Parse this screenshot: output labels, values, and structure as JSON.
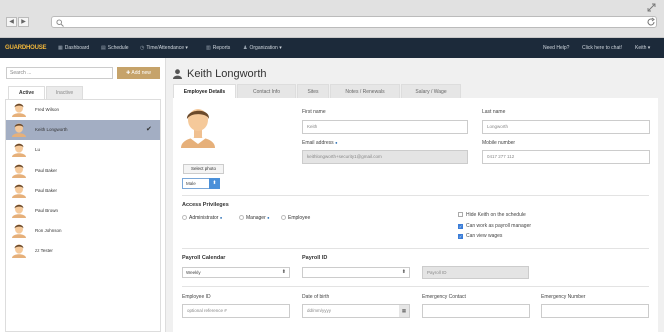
{
  "browser": {
    "back": "◀",
    "forward": "▶",
    "url": ""
  },
  "appbar": {
    "logo": "GUARDHOUSE",
    "items": [
      {
        "icon": "dashboard-icon",
        "label": "Dashboard"
      },
      {
        "icon": "calendar-icon",
        "label": "Schedule"
      },
      {
        "icon": "clock-icon",
        "label": "Time/Attendance",
        "caret": "▾"
      },
      {
        "icon": "bar-chart-icon",
        "label": "Reports"
      },
      {
        "icon": "users-icon",
        "label": "Organization",
        "caret": "▾"
      }
    ],
    "help": "Need Help?",
    "chat": "Click here to chat!",
    "user": "Keith",
    "user_caret": "▾"
  },
  "sidebar": {
    "search_placeholder": "Search ...",
    "add_new": "Add new",
    "tabs": [
      "Active",
      "Inactive"
    ],
    "people": [
      {
        "name": "Fred Wilson"
      },
      {
        "name": "Keith Longworth",
        "selected": true
      },
      {
        "name": "Lu"
      },
      {
        "name": "Paul Baker"
      },
      {
        "name": "Paul Baker"
      },
      {
        "name": "Paul Brown"
      },
      {
        "name": "Ron Johnson"
      },
      {
        "name": "zz Tester"
      }
    ]
  },
  "main": {
    "title": "Keith Longworth",
    "tabs": [
      "Employee Details",
      "Contact Info",
      "Sites",
      "Notes / Renewals",
      "Salary / Wage"
    ],
    "select_photo": "Select photo",
    "gender": "Male",
    "first_name_label": "First name",
    "first_name": "Keith",
    "last_name_label": "Last name",
    "last_name": "Longworth",
    "email_label": "Email address",
    "email": "keithlongworth+security1@gmail.com",
    "mobile_label": "Mobile number",
    "mobile": "0417 277 112",
    "access_title": "Access Privileges",
    "roles": [
      "Administrator",
      "Manager",
      "Employee"
    ],
    "options": [
      {
        "label": "Hide Keith on the schedule",
        "checked": false
      },
      {
        "label": "Can work as payroll manager",
        "checked": true
      },
      {
        "label": "Can view wages",
        "checked": true
      }
    ],
    "payroll_cal_label": "Payroll Calendar",
    "payroll_cal": "Weekly",
    "payroll_id_label": "Payroll ID",
    "payroll_id_sel": "",
    "payroll_id_placeholder": "Payroll ID",
    "employee_id_label": "Employee ID",
    "employee_id_placeholder": "optional reference #",
    "dob_label": "Date of birth",
    "dob_placeholder": "dd/mm/yyyy",
    "emergency_contact_label": "Emergency Contact",
    "emergency_number_label": "Emergency Number"
  },
  "colors": {
    "navbar": "#1c2a3a",
    "accent": "#c6a36a",
    "selected_row": "#a3aec3",
    "logo": "#f2b73a"
  }
}
